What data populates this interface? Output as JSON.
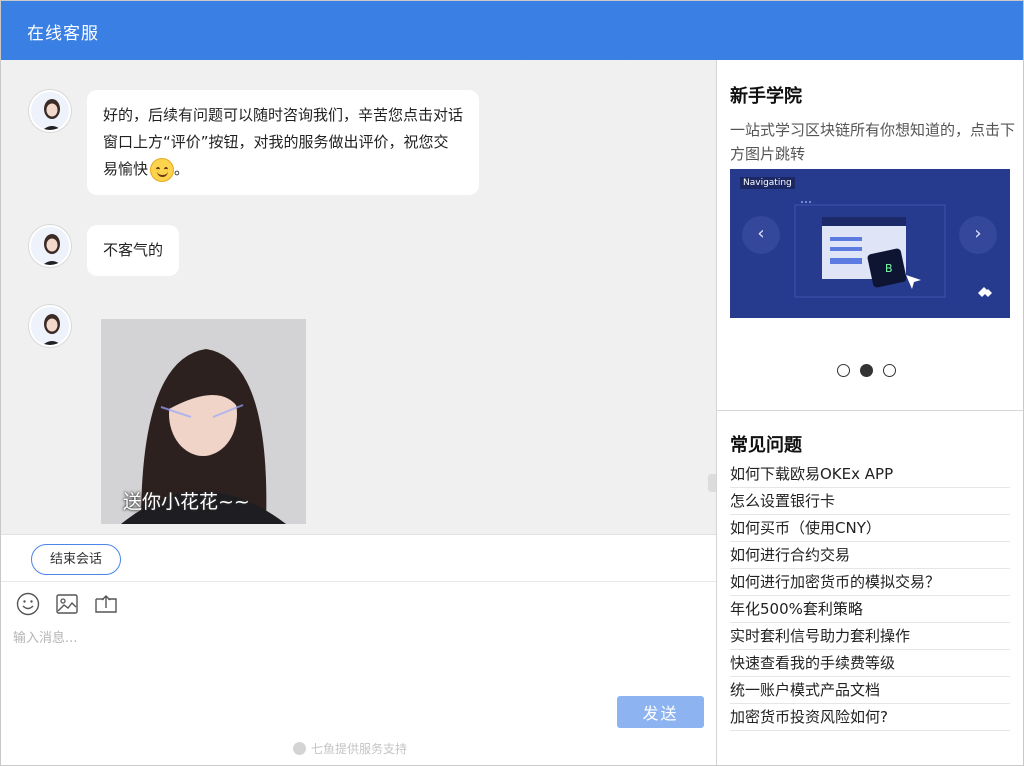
{
  "header": {
    "title": "在线客服"
  },
  "chat": {
    "messages": [
      {
        "type": "text",
        "text": "好的，后续有问题可以随时咨询我们，辛苦您点击对话窗口上方“评价”按钮，对我的服务做出评价，祝您交易愉快",
        "suffix": "。"
      },
      {
        "type": "text",
        "text": "不客气的"
      },
      {
        "type": "image",
        "caption": "送你小花花~~"
      }
    ]
  },
  "actions": {
    "end_session": "结束会话"
  },
  "composer": {
    "placeholder": "输入消息...",
    "send_label": "发送",
    "powered_by": "七鱼提供服务支持",
    "tools": [
      "emoji-icon",
      "image-icon",
      "upload-icon"
    ]
  },
  "sidebar": {
    "academy": {
      "title": "新手学院",
      "description": "一站式学习区块链所有你想知道的，点击下方图片跳转",
      "slide_tag": "Navigating",
      "current_slide": 2,
      "total_slides": 3
    },
    "faq": {
      "title": "常见问题",
      "items": [
        "如何下载欧易OKEx APP",
        "怎么设置银行卡",
        "如何买币（使用CNY）",
        "如何进行合约交易",
        "如何进行加密货币的模拟交易？",
        "年化500%套利策略",
        "实时套利信号助力套利操作",
        "快速查看我的手续费等级",
        "统一账户模式产品文档",
        "加密货币投资风险如何?"
      ]
    }
  },
  "colors": {
    "brand": "#3a7fe4",
    "send_button": "#8db4f0",
    "carousel_bg": "#263a8e"
  }
}
